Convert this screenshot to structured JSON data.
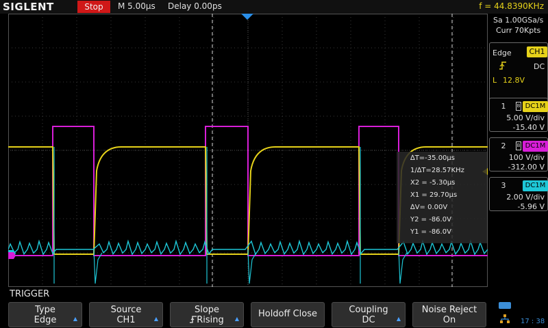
{
  "header": {
    "logo": "SIGLENT",
    "run_state": "Stop",
    "timebase": "M 5.00µs",
    "delay": "Delay 0.00ps",
    "frequency": "f = 44.8390KHz"
  },
  "acquisition": {
    "sample_rate": "Sa 1.00GSa/s",
    "memory_depth": "Curr 70Kpts"
  },
  "trigger_info": {
    "type": "Edge",
    "source": "CH1",
    "slope_icon": "rising-edge-icon",
    "coupling": "DC",
    "level_label": "L",
    "level": "12.8V"
  },
  "channels": [
    {
      "number": "1",
      "coupling": "DC1M",
      "volts_per_div": "5.00 V/div",
      "offset": "-15.40 V",
      "color": "#e6d21a"
    },
    {
      "number": "2",
      "coupling": "DC1M",
      "volts_per_div": "100 V/div",
      "offset": "-312.00 V",
      "color": "#d81ed8"
    },
    {
      "number": "3",
      "coupling": "DC1M",
      "volts_per_div": "2.00 V/div",
      "offset": "-5.96 V",
      "color": "#1ec8d8"
    }
  ],
  "cursor_readout": {
    "delta_t": "∆T=-35.00µs",
    "inv_delta_t": "1/∆T=28.57KHz",
    "x2": "X2 = -5.30µs",
    "x1": "X1 = 29.70µs",
    "delta_v": "∆V= 0.00V",
    "y2": "Y2 = -86.0V",
    "y1": "Y1 = -86.0V"
  },
  "menu": {
    "title": "TRIGGER",
    "softkeys": [
      {
        "line1": "Type",
        "line2": "Edge"
      },
      {
        "line1": "Source",
        "line2": "CH1"
      },
      {
        "line1": "Slope",
        "line2": "Rising"
      },
      {
        "line1": "Holdoff Close",
        "line2": ""
      },
      {
        "line1": "Coupling",
        "line2": "DC"
      },
      {
        "line1": "Noise Reject",
        "line2": "On"
      }
    ]
  },
  "status": {
    "clock": "17 : 38"
  },
  "colors": {
    "ch1": "#e6d21a",
    "ch2": "#d81ed8",
    "ch3": "#1ec8d8",
    "stop": "#d01818",
    "accent": "#3b8ed8"
  }
}
